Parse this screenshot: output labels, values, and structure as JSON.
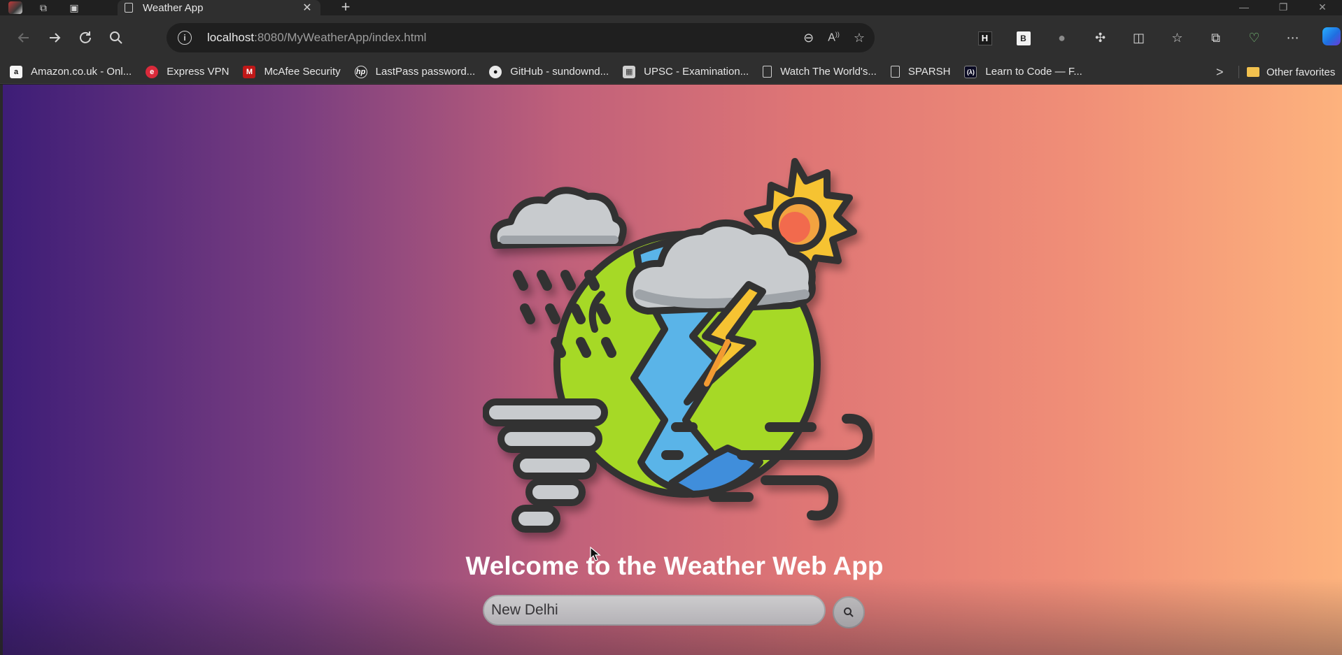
{
  "browser": {
    "tab": {
      "title": "Weather App",
      "close": "✕"
    },
    "new_tab": "+",
    "window": {
      "minimize": "—",
      "restore": "❐",
      "close": "✕"
    },
    "address": {
      "host": "localhost",
      "path": ":8080/MyWeatherApp/index.html",
      "info": "i"
    },
    "bookmarks": [
      {
        "label": "Amazon.co.uk - Onl...",
        "icon": "amazon-icon",
        "glyph": "a"
      },
      {
        "label": "Express VPN",
        "icon": "expressvpn-icon",
        "glyph": "e"
      },
      {
        "label": "McAfee Security",
        "icon": "mcafee-icon",
        "glyph": "M"
      },
      {
        "label": "LastPass password...",
        "icon": "hp-icon",
        "glyph": "hp"
      },
      {
        "label": "GitHub - sundownd...",
        "icon": "github-icon",
        "glyph": "●"
      },
      {
        "label": "UPSC - Examination...",
        "icon": "upsc-icon",
        "glyph": "▦"
      },
      {
        "label": "Watch The World's...",
        "icon": "page-icon",
        "glyph": ""
      },
      {
        "label": "SPARSH",
        "icon": "page-icon",
        "glyph": ""
      },
      {
        "label": "Learn to Code — F...",
        "icon": "freecodecamp-icon",
        "glyph": "(λ)"
      }
    ],
    "other_favorites": "Other favorites",
    "more_bookmarks": ">",
    "ext_h": "H",
    "ext_b": "B"
  },
  "app": {
    "welcome": "Welcome to the Weather Web App",
    "search_value": "New Delhi",
    "search_placeholder": ""
  }
}
